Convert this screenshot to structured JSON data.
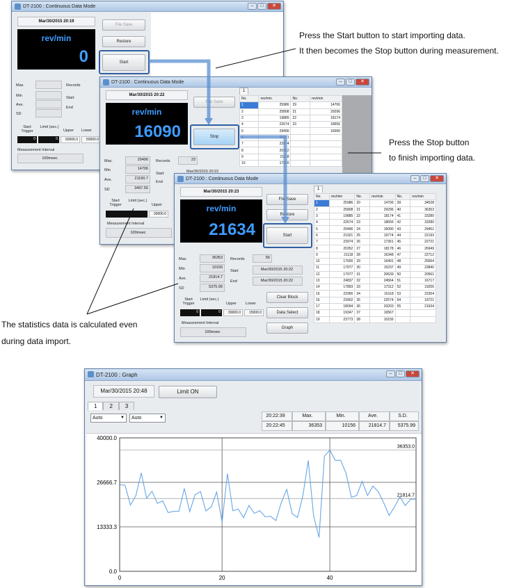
{
  "app_title": "DT-2100 : Continuous Data Mode",
  "graph_title": "DT-2100 : Graph",
  "close_glyph": "✕",
  "w1": {
    "date": "Mar/30/2015 20:19",
    "unit": "rev/min",
    "value": "0",
    "file_save": "File Save",
    "restore": "Restore",
    "start": "Start",
    "max": "Max.",
    "min": "Min",
    "ave": "Ave.",
    "sd": "SD",
    "records": "Records",
    "start_lbl": "Start",
    "end_lbl": "End",
    "start_trigger": "Start Trigger",
    "limit": "Limit (sec.)",
    "upper": "Upper",
    "lower": "Lower",
    "upper_val": "50000.0",
    "lower_val": "50000.0",
    "trig_val": "0",
    "limit_val": "0",
    "interval_lbl": "Measurement Interval",
    "interval": "100msec"
  },
  "w2": {
    "date": "Mar/30/2015 20:22",
    "unit": "rev/min",
    "value": "16090",
    "file_save": "File Save",
    "stop": "Stop",
    "max": "Max.",
    "min": "Min",
    "ave": "Ave.",
    "sd": "SD",
    "max_val": "29496",
    "min_val": "14706",
    "ave_val": "21190.7",
    "sd_val": "3497.55",
    "records": "Records",
    "records_val": "23",
    "start_lbl": "Start",
    "end_lbl": "End",
    "start_val": "Mar/30/2015 20:22",
    "start_trigger": "Start Trigger",
    "limit": "Limit (sec.)",
    "upper": "Upper",
    "upper_val": "30000.0",
    "interval_lbl": "Measurement Interval",
    "interval": "100msec",
    "tab": "1",
    "cols": [
      "No.",
      "rev/min",
      "No.",
      "rev/min"
    ],
    "rows": [
      [
        "1",
        "25986",
        "29",
        "14706"
      ],
      [
        "2",
        "25808",
        "21",
        "29296"
      ],
      [
        "3",
        "19885",
        "22",
        "18174"
      ],
      [
        "4",
        "22674",
        "23",
        "18656"
      ],
      [
        "5",
        "29496",
        "",
        "16090"
      ],
      [
        "6",
        "21921",
        "",
        ""
      ],
      [
        "7",
        "23974",
        "",
        ""
      ],
      [
        "8",
        "20352",
        "",
        ""
      ],
      [
        "9",
        "21118",
        "",
        ""
      ],
      [
        "10",
        "17600",
        "",
        ""
      ]
    ]
  },
  "w3": {
    "date": "Mar/30/2015 20:23",
    "unit": "rev/min",
    "value": "21634",
    "file_save": "File Save",
    "restore": "Restore",
    "start": "Start",
    "max": "Max.",
    "min": "Min",
    "ave": "Ave.",
    "sd": "SD",
    "max_val": "36353",
    "min_val": "10156",
    "ave_val": "21814.7",
    "sd_val": "5375.99",
    "records": "Records",
    "records_val": "56",
    "start_lbl": "Start",
    "end_lbl": "End",
    "start_val": "Mar/30/2015 20:22",
    "end_val": "Mar/30/2015 20:22",
    "start_trigger": "Start Trigger",
    "limit": "Limit (sec.)",
    "upper": "Upper",
    "lower": "Lower",
    "upper_val": "30000.0",
    "lower_val": "15000.0",
    "trig_val": "0",
    "limit_val": "0",
    "interval_lbl": "Measurement Interval",
    "interval": "100msec",
    "clear_block": "Clear Block",
    "data_select": "Data Select",
    "graph": "Graph",
    "tab": "1",
    "cols": [
      "No.",
      "rev/min",
      "No.",
      "rev/min",
      "No.",
      "rev/min"
    ],
    "rows": [
      [
        "1",
        "25986",
        "20",
        "14706",
        "39",
        "34528"
      ],
      [
        "2",
        "25808",
        "21",
        "29296",
        "40",
        "36353"
      ],
      [
        "3",
        "19885",
        "22",
        "18174",
        "41",
        "33280"
      ],
      [
        "4",
        "22674",
        "23",
        "18656",
        "42",
        "33280"
      ],
      [
        "5",
        "29496",
        "24",
        "16090",
        "43",
        "29451"
      ],
      [
        "6",
        "21921",
        "25",
        "19774",
        "44",
        "22193"
      ],
      [
        "7",
        "23974",
        "26",
        "17361",
        "45",
        "22721"
      ],
      [
        "8",
        "20352",
        "27",
        "18178",
        "46",
        "26949"
      ],
      [
        "9",
        "21118",
        "28",
        "16348",
        "47",
        "22712"
      ],
      [
        "10",
        "17600",
        "29",
        "16491",
        "48",
        "25564"
      ],
      [
        "11",
        "17977",
        "30",
        "15237",
        "49",
        "23840"
      ],
      [
        "12",
        "17977",
        "31",
        "20639",
        "50",
        "20561"
      ],
      [
        "13",
        "24837",
        "32",
        "24564",
        "51",
        "16717"
      ],
      [
        "14",
        "17893",
        "33",
        "17312",
        "52",
        "19256"
      ],
      [
        "15",
        "22956",
        "34",
        "16118",
        "53",
        "22304"
      ],
      [
        "16",
        "23902",
        "35",
        "22574",
        "54",
        "19721"
      ],
      [
        "17",
        "18094",
        "36",
        "33203",
        "55",
        "21634"
      ],
      [
        "18",
        "19347",
        "37",
        "16567",
        "",
        ""
      ],
      [
        "19",
        "23773",
        "38",
        "10156",
        "",
        ""
      ]
    ]
  },
  "annotations": {
    "a1_l1": "Press the Start button to start importing data.",
    "a1_l2": "It then becomes the Stop button during measurement.",
    "a2_l1": "Press the Stop button",
    "a2_l2": "to finish importing data.",
    "a3_l1": "The statistics data is calculated even",
    "a3_l2": "during data import."
  },
  "graph": {
    "date": "Mar/30/2015 20:48",
    "limit_on": "Limit ON",
    "tabs": [
      "1",
      "2",
      "3"
    ],
    "dd1": "Auto",
    "dd2": "Auto",
    "time1": "20:22:39",
    "time2": "20:22:45",
    "hdr_max": "Max.",
    "hdr_min": "Min.",
    "hdr_ave": "Ave.",
    "hdr_sd": "S.D.",
    "max": "36353",
    "min": "10156",
    "ave": "21814.7",
    "sd": "5375.99",
    "max_line_label": "36353.0",
    "ave_line_label": "21814.7"
  },
  "chart_data": {
    "type": "line",
    "yticks": [
      "40000.0",
      "26666.7",
      "13333.3",
      "0.0"
    ],
    "xticks": [
      "0",
      "20",
      "40"
    ],
    "ylim": [
      0,
      40000
    ],
    "xlim": [
      1,
      56
    ],
    "ref_lines": [
      36353.0,
      21814.7
    ],
    "x": [
      1,
      2,
      3,
      4,
      5,
      6,
      7,
      8,
      9,
      10,
      11,
      12,
      13,
      14,
      15,
      16,
      17,
      18,
      19,
      20,
      21,
      22,
      23,
      24,
      25,
      26,
      27,
      28,
      29,
      30,
      31,
      32,
      33,
      34,
      35,
      36,
      37,
      38,
      39,
      40,
      41,
      42,
      43,
      44,
      45,
      46,
      47,
      48,
      49,
      50,
      51,
      52,
      53,
      54,
      55,
      56
    ],
    "values": [
      25986,
      25808,
      19885,
      22674,
      29496,
      21921,
      23974,
      20352,
      21118,
      17600,
      17977,
      17977,
      24837,
      17893,
      22956,
      23902,
      18094,
      19347,
      23773,
      14706,
      29296,
      18174,
      18656,
      16090,
      19774,
      17361,
      18178,
      16348,
      16491,
      15237,
      20639,
      24564,
      17312,
      16118,
      22574,
      33203,
      16567,
      10156,
      34528,
      36353,
      33280,
      33280,
      29451,
      22193,
      22721,
      26949,
      22712,
      25564,
      23840,
      20561,
      16717,
      19256,
      22304,
      19721,
      21634,
      21634
    ]
  }
}
